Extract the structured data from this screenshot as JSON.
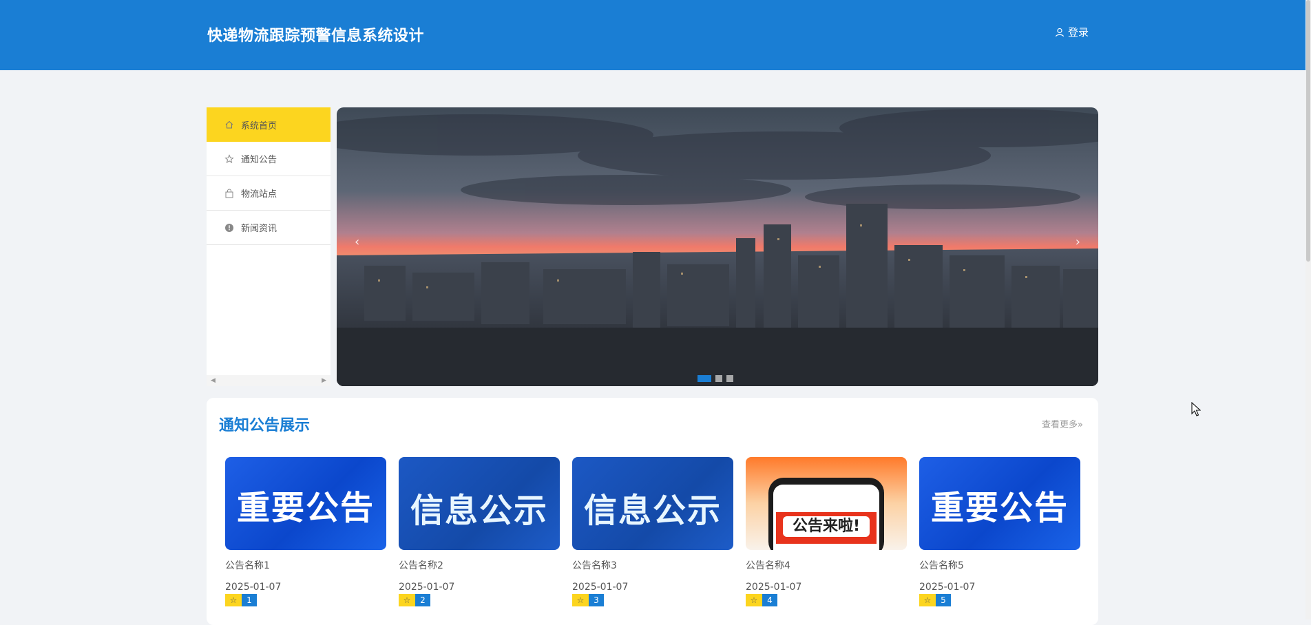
{
  "header": {
    "site_title": "快递物流跟踪预警信息系统设计",
    "login_label": "登录"
  },
  "sidebar": {
    "items": [
      {
        "label": "系统首页",
        "icon": "home-icon",
        "active": true
      },
      {
        "label": "通知公告",
        "icon": "star-icon",
        "active": false
      },
      {
        "label": "物流站点",
        "icon": "bag-icon",
        "active": false
      },
      {
        "label": "新闻资讯",
        "icon": "info-icon",
        "active": false
      }
    ]
  },
  "banner": {
    "slide_count": 3,
    "active_slide": 1,
    "prev_glyph": "‹",
    "next_glyph": "›"
  },
  "notices": {
    "title": "通知公告展示",
    "more_label": "查看更多»",
    "items": [
      {
        "name": "公告名称1",
        "date": "2025-01-07",
        "count": "1",
        "image_text": "重要公告"
      },
      {
        "name": "公告名称2",
        "date": "2025-01-07",
        "count": "2",
        "image_text": "信息公示"
      },
      {
        "name": "公告名称3",
        "date": "2025-01-07",
        "count": "3",
        "image_text": "信息公示"
      },
      {
        "name": "公告名称4",
        "date": "2025-01-07",
        "count": "4",
        "image_text": "公告来啦!"
      },
      {
        "name": "公告名称5",
        "date": "2025-01-07",
        "count": "5",
        "image_text": "重要公告"
      }
    ]
  },
  "colors": {
    "primary": "#1a7ed4",
    "accent": "#fcd51f",
    "background": "#f1f3f6"
  }
}
